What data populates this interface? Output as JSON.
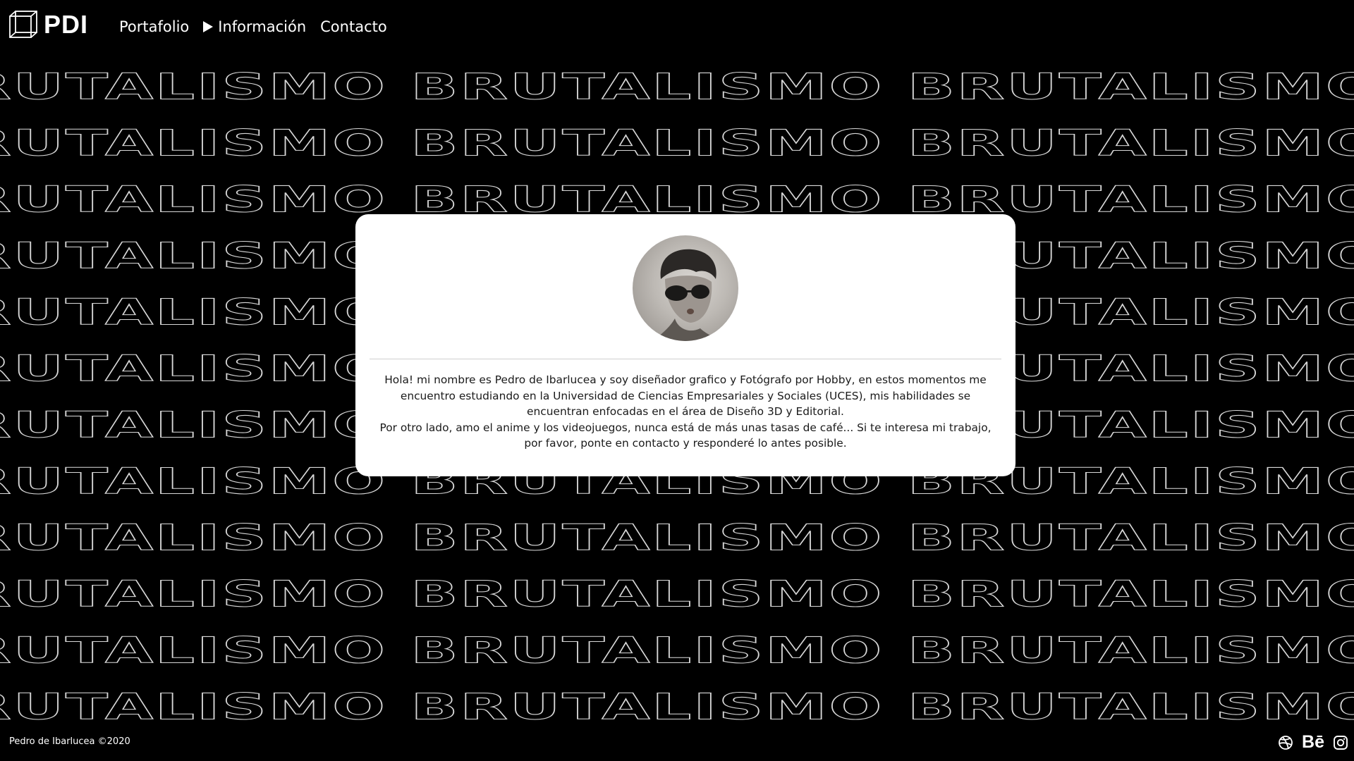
{
  "brand": {
    "logo_text": "PDI",
    "logo_icon": "wireframe-cube-icon"
  },
  "nav": {
    "items": [
      {
        "label": "Portafolio",
        "active": false
      },
      {
        "label": "Información",
        "active": true
      },
      {
        "label": "Contacto",
        "active": false
      }
    ]
  },
  "background": {
    "pattern_text": "BRUTALISMO BRUTALISMO BRUTALISMO BRUTALISMO",
    "rows": 12
  },
  "profile": {
    "avatar_icon": "profile-photo",
    "bio_paragraphs": [
      "Hola! mi nombre es Pedro de Ibarlucea y soy diseñador grafico y Fotógrafo por Hobby, en estos momentos me encuentro estudiando en la Universidad de Ciencias Empresariales y Sociales (UCES), mis habilidades se encuentran enfocadas en el área de Diseño 3D y Editorial.",
      "Por otro lado, amo el anime y los videojuegos, nunca está de más unas tasas de café... Si te interesa mi trabajo, por favor, ponte en contacto y responderé lo antes posible."
    ]
  },
  "footer": {
    "copyright": "Pedro de Ibarlucea ©2020",
    "social": [
      {
        "name": "dribbble-icon"
      },
      {
        "name": "behance-icon",
        "label": "Bē"
      },
      {
        "name": "instagram-icon"
      }
    ]
  },
  "colors": {
    "background": "#000000",
    "card": "#ffffff",
    "text_light": "#ffffff",
    "text_dark": "#111111",
    "outline": "#d8d8d8"
  }
}
